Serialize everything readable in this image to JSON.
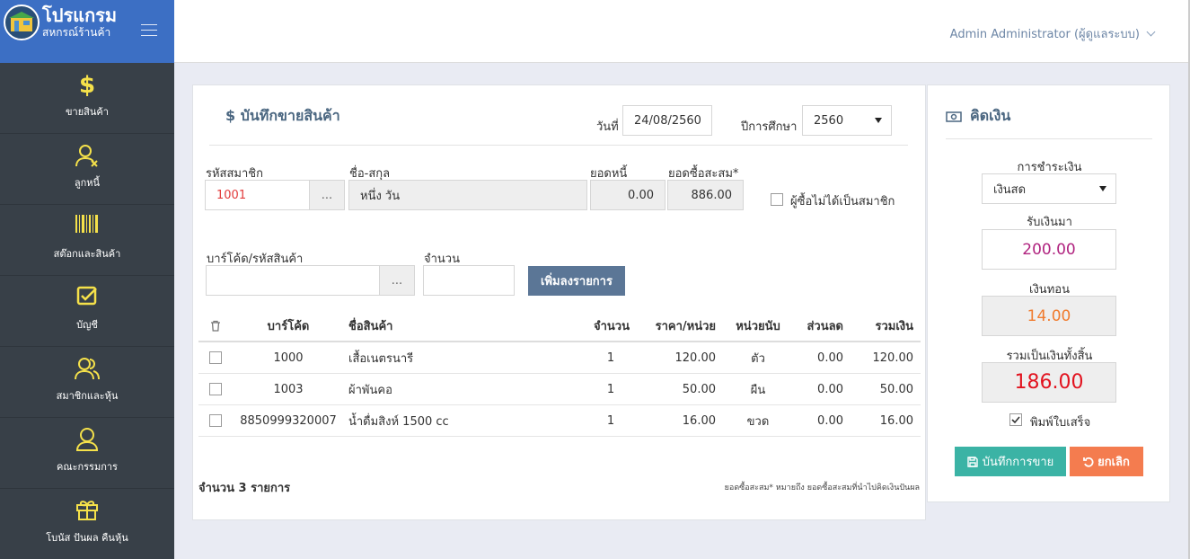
{
  "brand": {
    "title": "โปรแกรม",
    "subtitle": "สหกรณ์ร้านค้า"
  },
  "user": {
    "name": "Admin Administrator (ผู้ดูแลระบบ)"
  },
  "sidebar": {
    "items": [
      {
        "label": "ขายสินค้า",
        "icon": "dollar-icon"
      },
      {
        "label": "ลูกหนี้",
        "icon": "user-x-icon"
      },
      {
        "label": "สต๊อกและสินค้า",
        "icon": "barcode-icon"
      },
      {
        "label": "บัญชี",
        "icon": "check-square-icon"
      },
      {
        "label": "สมาชิกและหุ้น",
        "icon": "users-icon"
      },
      {
        "label": "คณะกรรมการ",
        "icon": "user-icon"
      },
      {
        "label": "โบนัส ปันผล คืนหุ้น",
        "icon": "gift-icon"
      }
    ]
  },
  "sale": {
    "title": "บันทึกขายสินค้า",
    "date_label": "วันที่",
    "date_value": "24/08/2560",
    "year_label": "ปีการศึกษา",
    "year_value": "2560",
    "member_code_label": "รหัสสมาชิก",
    "member_code_value": "1001",
    "name_label": "ชื่อ-สกุล",
    "name_value": "หนึ่ง วัน",
    "debt_label": "ยอดหนี้",
    "debt_value": "0.00",
    "accum_label": "ยอดซื้อสะสม*",
    "accum_value": "886.00",
    "non_member_label": "ผู้ซื้อไม่ได้เป็นสมาชิก",
    "dots": "...",
    "barcode_label": "บาร์โค้ด/รหัสสินค้า",
    "barcode_value": "",
    "qty_label": "จำนวน",
    "qty_value": "",
    "add_button": "เพิ่มลงรายการ"
  },
  "table": {
    "headers": [
      "บาร์โค้ด",
      "ชื่อสินค้า",
      "จำนวน",
      "ราคา/หน่วย",
      "หน่วยนับ",
      "ส่วนลด",
      "รวมเงิน"
    ],
    "rows": [
      [
        "1000",
        "เสื้อเนตรนารี",
        "1",
        "120.00",
        "ตัว",
        "0.00",
        "120.00"
      ],
      [
        "1003",
        "ผ้าพันคอ",
        "1",
        "50.00",
        "ผืน",
        "0.00",
        "50.00"
      ],
      [
        "8850999320007",
        "น้ำดื่มสิงห์ 1500 cc",
        "1",
        "16.00",
        "ขวด",
        "0.00",
        "16.00"
      ]
    ],
    "count_text": "จำนวน 3 รายการ",
    "note": "ยอดซื้อสะสม* หมายถึง ยอดซื้อสะสมที่นำไปคิดเงินปันผล"
  },
  "payment": {
    "title": "คิดเงิน",
    "method_label": "การชำระเงิน",
    "method_value": "เงินสด",
    "received_label": "รับเงินมา",
    "received_value": "200.00",
    "change_label": "เงินทอน",
    "change_value": "14.00",
    "total_label": "รวมเป็นเงินทั้งสิ้น",
    "total_value": "186.00",
    "print_label": "พิมพ์ใบเสร็จ",
    "print_checked": true,
    "save_button": "บันทึกการขาย",
    "cancel_button": "ยกเลิก"
  },
  "colors": {
    "brand": "#3c6fc4",
    "sidebar": "#384048",
    "icon_yellow": "#f5e14a",
    "member_code": "#e23b3b",
    "received": "#b0237f",
    "change": "#f07b2e",
    "total": "#e2131f",
    "save": "#3bb3a5",
    "cancel": "#f47c4f"
  }
}
